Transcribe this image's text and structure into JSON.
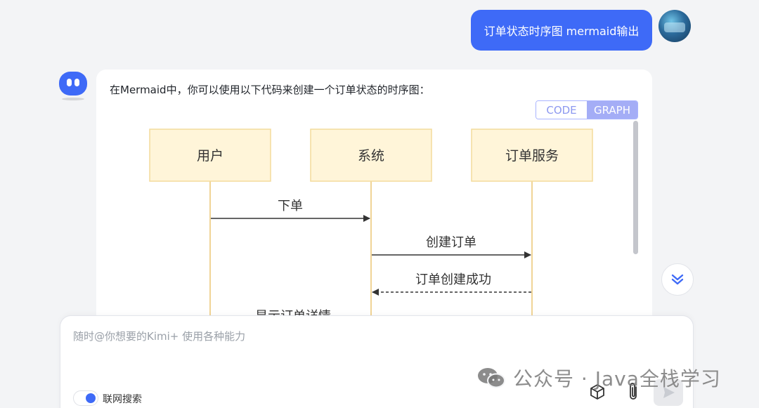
{
  "user_message": {
    "text": "订单状态时序图 mermaid输出"
  },
  "bot": {
    "intro": "在Mermaid中，你可以使用以下代码来创建一个订单状态的时序图：",
    "view_toggle": {
      "code": "CODE",
      "graph": "GRAPH",
      "selected": "GRAPH"
    }
  },
  "diagram": {
    "participants": [
      "用户",
      "系统",
      "订单服务"
    ],
    "messages": [
      {
        "label": "下单",
        "from": "用户",
        "to": "系统",
        "style": "solid"
      },
      {
        "label": "创建订单",
        "from": "系统",
        "to": "订单服务",
        "style": "solid"
      },
      {
        "label": "订单创建成功",
        "from": "订单服务",
        "to": "系统",
        "style": "dashed"
      },
      {
        "label": "显示订单详情",
        "from": "系统",
        "to": "用户",
        "style": "dashed"
      }
    ],
    "colors": {
      "box_fill": "#fff5d9",
      "box_stroke": "#f4dc9c",
      "lifeline": "#f0d496",
      "arrow": "#333333"
    }
  },
  "input": {
    "placeholder": "随时@你想要的Kimi+ 使用各种能力",
    "web_search_label": "联网搜索",
    "web_search_on": true
  },
  "icons": [
    "cube-icon",
    "paperclip-icon",
    "send-icon",
    "chevron-double-down-icon"
  ],
  "watermark": {
    "text": "公众号 · Java全栈学习"
  },
  "theme": {
    "accent": "#3e6af7",
    "background": "#f3f4f6"
  }
}
